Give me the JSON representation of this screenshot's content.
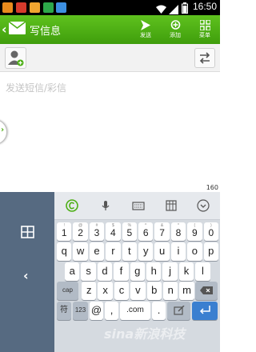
{
  "status_bar": {
    "time": "16:50"
  },
  "title_bar": {
    "title": "写信息",
    "actions": [
      {
        "icon": "send-icon",
        "label": "发送"
      },
      {
        "icon": "attach-icon",
        "label": "添加"
      },
      {
        "icon": "menu-grid-icon",
        "label": "菜单"
      }
    ]
  },
  "message": {
    "placeholder": "发送短信/彩信",
    "char_count": "160"
  },
  "keyboard": {
    "number_row": [
      {
        "sup": "!",
        "main": "1"
      },
      {
        "sup": "@",
        "main": "2"
      },
      {
        "sup": "#",
        "main": "3"
      },
      {
        "sup": "$",
        "main": "4"
      },
      {
        "sup": "%",
        "main": "5"
      },
      {
        "sup": "^",
        "main": "6"
      },
      {
        "sup": "&",
        "main": "7"
      },
      {
        "sup": "*",
        "main": "8"
      },
      {
        "sup": "(",
        "main": "9"
      },
      {
        "sup": ")",
        "main": "0"
      }
    ],
    "row1": [
      "q",
      "w",
      "e",
      "r",
      "t",
      "y",
      "u",
      "i",
      "o",
      "p"
    ],
    "row2": [
      "a",
      "s",
      "d",
      "f",
      "g",
      "h",
      "j",
      "k",
      "l"
    ],
    "row3": [
      "z",
      "x",
      "c",
      "v",
      "b",
      "n",
      "m"
    ],
    "cap_label": "cap",
    "bottom": {
      "symbols": "符",
      "numbers": "123",
      "at": "@",
      "comma": ",",
      "com": ".com",
      "period": "."
    }
  },
  "watermark": "sina新浪科技",
  "colors": {
    "titlebar_green": "#4caf15",
    "keyboard_side": "#566a81",
    "enter_blue": "#3a7fd0"
  }
}
